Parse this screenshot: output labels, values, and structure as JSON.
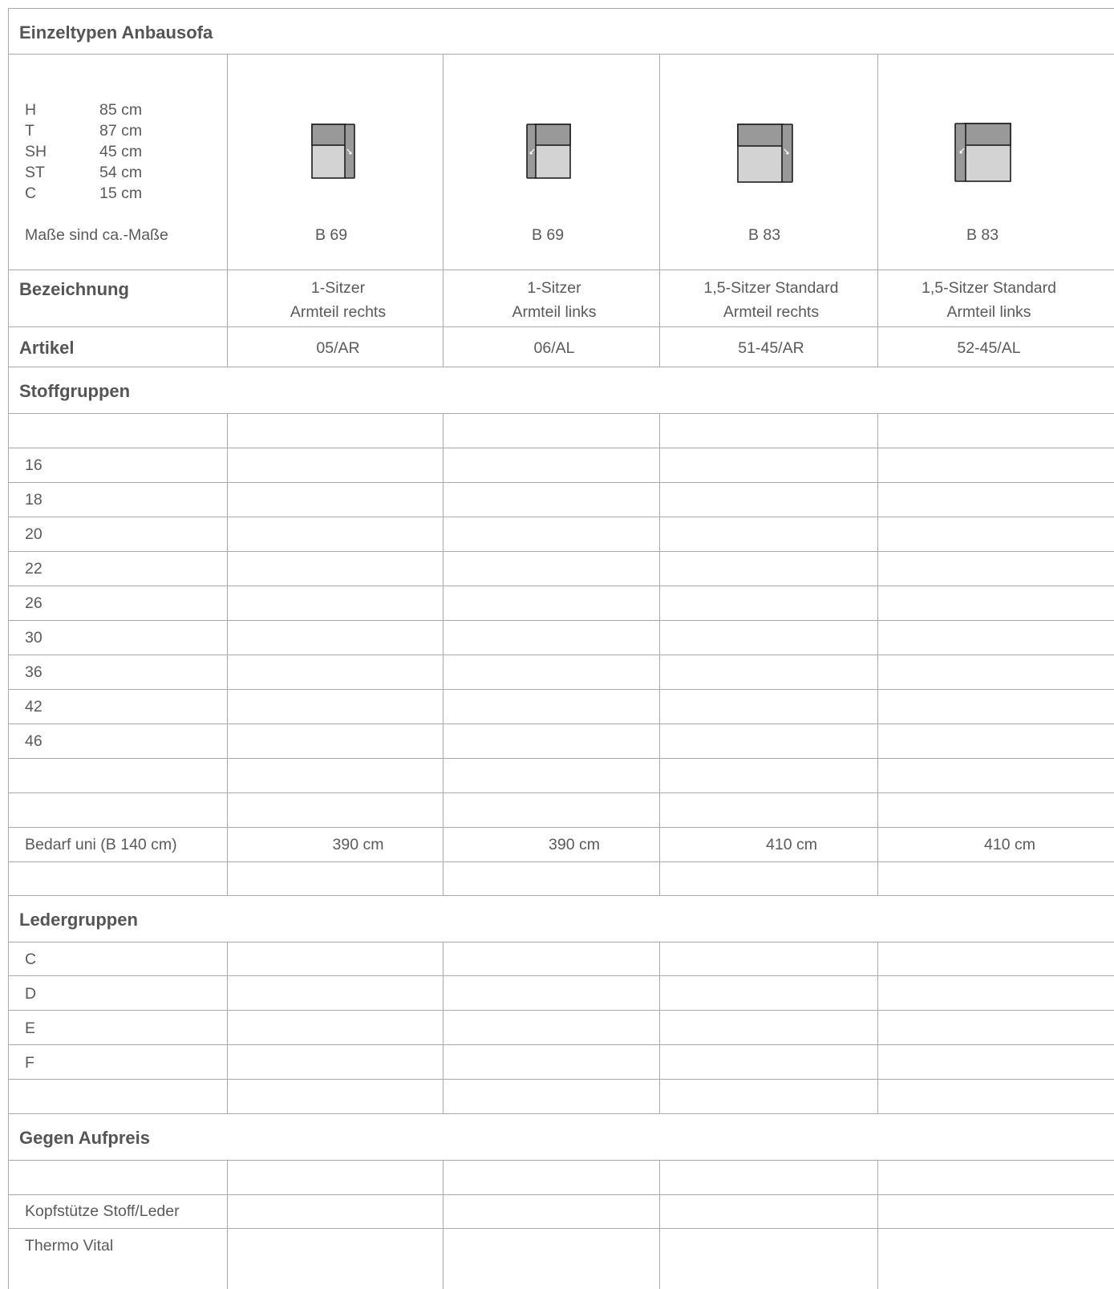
{
  "title": "Einzeltypen Anbausofa",
  "dimensions": [
    {
      "key": "H",
      "value": "85 cm"
    },
    {
      "key": "T",
      "value": "87 cm"
    },
    {
      "key": "SH",
      "value": "45 cm"
    },
    {
      "key": "ST",
      "value": "54 cm"
    },
    {
      "key": "C",
      "value": "15 cm"
    }
  ],
  "dimensions_note": "Maße sind ca.-Maße",
  "columns": [
    {
      "icon": "sofa-module-armrest-right-icon",
      "width": "B 69",
      "name_line1": "1-Sitzer",
      "name_line2": "Armteil rechts",
      "article": "05/AR",
      "fabric_need": "390 cm"
    },
    {
      "icon": "sofa-module-armrest-left-icon",
      "width": "B 69",
      "name_line1": "1-Sitzer",
      "name_line2": "Armteil links",
      "article": "06/AL",
      "fabric_need": "390 cm"
    },
    {
      "icon": "sofa-module-armrest-right-icon",
      "width": "B 83",
      "name_line1": "1,5-Sitzer Standard",
      "name_line2": "Armteil rechts",
      "article": "51-45/AR",
      "fabric_need": "410 cm"
    },
    {
      "icon": "sofa-module-armrest-left-icon",
      "width": "B 83",
      "name_line1": "1,5-Sitzer Standard",
      "name_line2": "Armteil links",
      "article": "52-45/AL",
      "fabric_need": "410 cm"
    }
  ],
  "labels": {
    "designation": "Bezeichnung",
    "article": "Artikel",
    "fabric_groups": "Stoffgruppen",
    "leather_groups": "Ledergruppen",
    "extra_cost": "Gegen Aufpreis"
  },
  "fabric_group_rows": [
    "",
    "16",
    "18",
    "20",
    "22",
    "26",
    "30",
    "36",
    "42",
    "46",
    "",
    "",
    "Bedarf uni (B 140 cm)",
    ""
  ],
  "leather_group_rows": [
    "C",
    "D",
    "E",
    "F",
    ""
  ],
  "extra_rows": [
    "",
    "Kopfstütze Stoff/Leder",
    "Thermo Vital"
  ],
  "colors": {
    "line": "#a9a9a9",
    "text": "#5a5a5a",
    "icon_dark": "#999999",
    "icon_light": "#d3d3d3",
    "icon_outline": "#1e1e1e"
  }
}
